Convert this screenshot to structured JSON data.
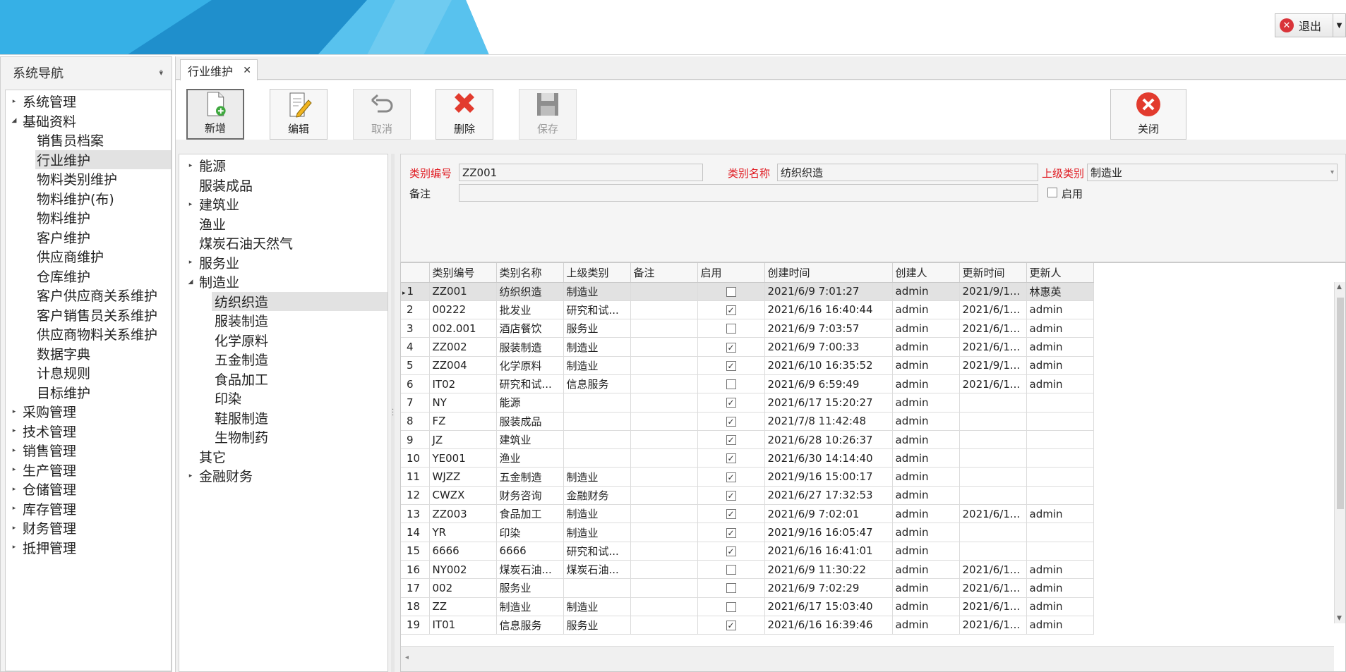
{
  "header": {
    "logout_label": "退出",
    "accent": "#29a3dd"
  },
  "nav": {
    "title": "系统导航",
    "items": [
      {
        "label": "系统管理",
        "type": "group",
        "expanded": false
      },
      {
        "label": "基础资料",
        "type": "group",
        "expanded": true
      },
      {
        "label": "销售员档案",
        "type": "child"
      },
      {
        "label": "行业维护",
        "type": "child",
        "selected": true
      },
      {
        "label": "物料类别维护",
        "type": "child"
      },
      {
        "label": "物料维护(布)",
        "type": "child"
      },
      {
        "label": "物料维护",
        "type": "child"
      },
      {
        "label": "客户维护",
        "type": "child"
      },
      {
        "label": "供应商维护",
        "type": "child"
      },
      {
        "label": "仓库维护",
        "type": "child"
      },
      {
        "label": "客户供应商关系维护",
        "type": "child"
      },
      {
        "label": "客户销售员关系维护",
        "type": "child"
      },
      {
        "label": "供应商物料关系维护",
        "type": "child"
      },
      {
        "label": "数据字典",
        "type": "child"
      },
      {
        "label": "计息规则",
        "type": "child"
      },
      {
        "label": "目标维护",
        "type": "child"
      },
      {
        "label": "采购管理",
        "type": "group",
        "expanded": false
      },
      {
        "label": "技术管理",
        "type": "group",
        "expanded": false
      },
      {
        "label": "销售管理",
        "type": "group",
        "expanded": false
      },
      {
        "label": "生产管理",
        "type": "group",
        "expanded": false
      },
      {
        "label": "仓储管理",
        "type": "group",
        "expanded": false
      },
      {
        "label": "库存管理",
        "type": "group",
        "expanded": false
      },
      {
        "label": "财务管理",
        "type": "group",
        "expanded": false
      },
      {
        "label": "抵押管理",
        "type": "group",
        "expanded": false
      }
    ]
  },
  "tab": {
    "label": "行业维护"
  },
  "toolbar": {
    "new": "新增",
    "edit": "编辑",
    "cancel": "取消",
    "delete": "删除",
    "save": "保存",
    "close": "关闭"
  },
  "tree": {
    "items": [
      {
        "label": "能源",
        "level": 0,
        "arrow": "right"
      },
      {
        "label": "服装成品",
        "level": 0,
        "arrow": "none"
      },
      {
        "label": "建筑业",
        "level": 0,
        "arrow": "right"
      },
      {
        "label": "渔业",
        "level": 0,
        "arrow": "none"
      },
      {
        "label": "煤炭石油天然气",
        "level": 0,
        "arrow": "none"
      },
      {
        "label": "服务业",
        "level": 0,
        "arrow": "right"
      },
      {
        "label": "制造业",
        "level": 0,
        "arrow": "down"
      },
      {
        "label": "纺织织造",
        "level": 1,
        "selected": true
      },
      {
        "label": "服装制造",
        "level": 1
      },
      {
        "label": "化学原料",
        "level": 1
      },
      {
        "label": "五金制造",
        "level": 1
      },
      {
        "label": "食品加工",
        "level": 1
      },
      {
        "label": "印染",
        "level": 1
      },
      {
        "label": "鞋服制造",
        "level": 1
      },
      {
        "label": "生物制药",
        "level": 1
      },
      {
        "label": "其它",
        "level": 0,
        "arrow": "none"
      },
      {
        "label": "金融财务",
        "level": 0,
        "arrow": "right"
      }
    ]
  },
  "form": {
    "code_label": "类别编号",
    "code_value": "ZZ001",
    "name_label": "类别名称",
    "name_value": "纺织织造",
    "parent_label": "上级类别",
    "parent_value": "制造业",
    "remark_label": "备注",
    "remark_value": "",
    "enabled_label": "启用",
    "enabled": false
  },
  "grid": {
    "columns": [
      "类别编号",
      "类别名称",
      "上级类别",
      "备注",
      "启用",
      "创建时间",
      "创建人",
      "更新时间",
      "更新人"
    ],
    "rows": [
      {
        "no": "1",
        "code": "ZZ001",
        "name": "纺织织造",
        "parent": "制造业",
        "remark": "",
        "enabled": false,
        "created": "2021/6/9 7:01:27",
        "creator": "admin",
        "updated": "2021/9/1...",
        "updater": "林惠英",
        "selected": true
      },
      {
        "no": "2",
        "code": "00222",
        "name": "批发业",
        "parent": "研究和试...",
        "remark": "",
        "enabled": true,
        "created": "2021/6/16 16:40:44",
        "creator": "admin",
        "updated": "2021/6/1...",
        "updater": "admin"
      },
      {
        "no": "3",
        "code": "002.001",
        "name": "酒店餐饮",
        "parent": "服务业",
        "remark": "",
        "enabled": false,
        "created": "2021/6/9 7:03:57",
        "creator": "admin",
        "updated": "2021/6/1...",
        "updater": "admin"
      },
      {
        "no": "4",
        "code": "ZZ002",
        "name": "服装制造",
        "parent": "制造业",
        "remark": "",
        "enabled": true,
        "created": "2021/6/9 7:00:33",
        "creator": "admin",
        "updated": "2021/6/1...",
        "updater": "admin"
      },
      {
        "no": "5",
        "code": "ZZ004",
        "name": "化学原料",
        "parent": "制造业",
        "remark": "",
        "enabled": true,
        "created": "2021/6/10 16:35:52",
        "creator": "admin",
        "updated": "2021/9/1...",
        "updater": "admin"
      },
      {
        "no": "6",
        "code": "IT02",
        "name": "研究和试...",
        "parent": "信息服务",
        "remark": "",
        "enabled": false,
        "created": "2021/6/9 6:59:49",
        "creator": "admin",
        "updated": "2021/6/1...",
        "updater": "admin"
      },
      {
        "no": "7",
        "code": "NY",
        "name": "能源",
        "parent": "",
        "remark": "",
        "enabled": true,
        "created": "2021/6/17 15:20:27",
        "creator": "admin",
        "updated": "",
        "updater": ""
      },
      {
        "no": "8",
        "code": "FZ",
        "name": "服装成品",
        "parent": "",
        "remark": "",
        "enabled": true,
        "created": "2021/7/8 11:42:48",
        "creator": "admin",
        "updated": "",
        "updater": ""
      },
      {
        "no": "9",
        "code": "JZ",
        "name": "建筑业",
        "parent": "",
        "remark": "",
        "enabled": true,
        "created": "2021/6/28 10:26:37",
        "creator": "admin",
        "updated": "",
        "updater": ""
      },
      {
        "no": "10",
        "code": "YE001",
        "name": "渔业",
        "parent": "",
        "remark": "",
        "enabled": true,
        "created": "2021/6/30 14:14:40",
        "creator": "admin",
        "updated": "",
        "updater": ""
      },
      {
        "no": "11",
        "code": "WJZZ",
        "name": "五金制造",
        "parent": "制造业",
        "remark": "",
        "enabled": true,
        "created": "2021/9/16 15:00:17",
        "creator": "admin",
        "updated": "",
        "updater": ""
      },
      {
        "no": "12",
        "code": "CWZX",
        "name": "财务咨询",
        "parent": "金融财务",
        "remark": "",
        "enabled": true,
        "created": "2021/6/27 17:32:53",
        "creator": "admin",
        "updated": "",
        "updater": ""
      },
      {
        "no": "13",
        "code": "ZZ003",
        "name": "食品加工",
        "parent": "制造业",
        "remark": "",
        "enabled": true,
        "created": "2021/6/9 7:02:01",
        "creator": "admin",
        "updated": "2021/6/1...",
        "updater": "admin"
      },
      {
        "no": "14",
        "code": "YR",
        "name": "印染",
        "parent": "制造业",
        "remark": "",
        "enabled": true,
        "created": "2021/9/16 16:05:47",
        "creator": "admin",
        "updated": "",
        "updater": ""
      },
      {
        "no": "15",
        "code": "6666",
        "name": "6666",
        "parent": "研究和试...",
        "remark": "",
        "enabled": true,
        "created": "2021/6/16 16:41:01",
        "creator": "admin",
        "updated": "",
        "updater": ""
      },
      {
        "no": "16",
        "code": "NY002",
        "name": "煤炭石油...",
        "parent": "煤炭石油...",
        "remark": "",
        "enabled": false,
        "created": "2021/6/9 11:30:22",
        "creator": "admin",
        "updated": "2021/6/1...",
        "updater": "admin"
      },
      {
        "no": "17",
        "code": "002",
        "name": "服务业",
        "parent": "",
        "remark": "",
        "enabled": false,
        "created": "2021/6/9 7:02:29",
        "creator": "admin",
        "updated": "2021/6/1...",
        "updater": "admin"
      },
      {
        "no": "18",
        "code": "ZZ",
        "name": "制造业",
        "parent": "制造业",
        "remark": "",
        "enabled": false,
        "created": "2021/6/17 15:03:40",
        "creator": "admin",
        "updated": "2021/6/1...",
        "updater": "admin"
      },
      {
        "no": "19",
        "code": "IT01",
        "name": "信息服务",
        "parent": "服务业",
        "remark": "",
        "enabled": true,
        "created": "2021/6/16 16:39:46",
        "creator": "admin",
        "updated": "2021/6/1...",
        "updater": "admin"
      }
    ]
  }
}
